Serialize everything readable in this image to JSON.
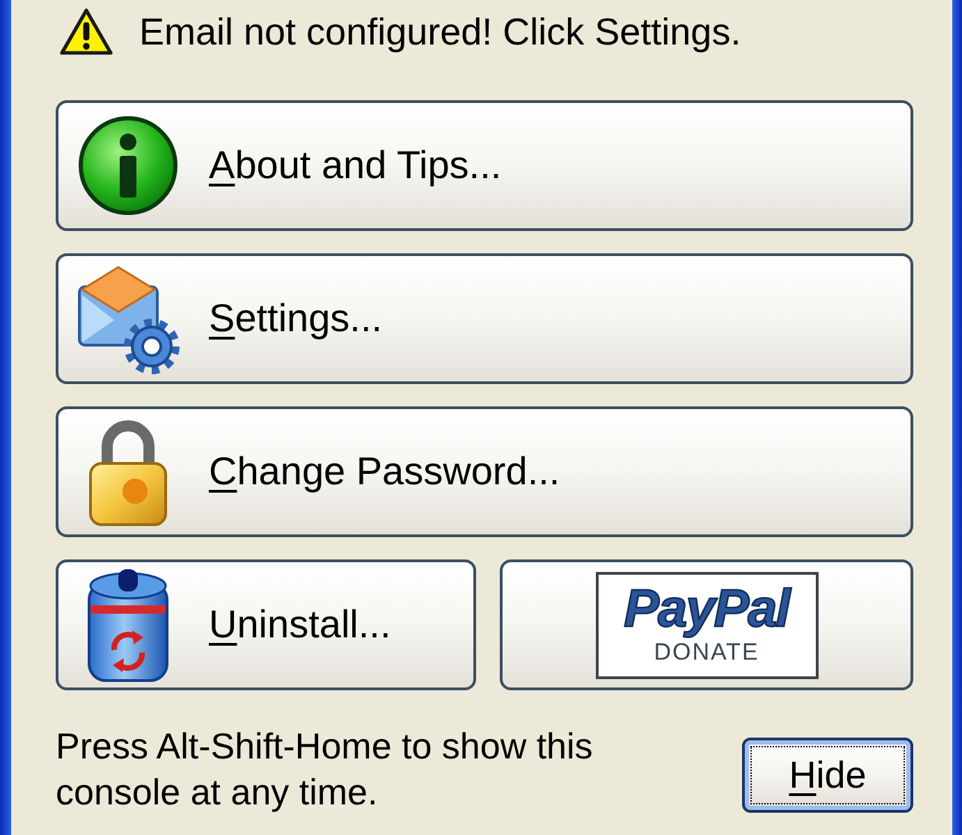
{
  "warning": {
    "text": "Email not configured! Click Settings."
  },
  "buttons": [
    {
      "kind": "info",
      "label": "About and Tips...",
      "initial_underlined": true
    },
    {
      "kind": "settings",
      "label": "Settings...",
      "initial_underlined": true
    },
    {
      "kind": "password",
      "label": "Change Password...",
      "initial_underlined": true
    },
    {
      "kind": "uninstall",
      "label": "Uninstall...",
      "initial_underlined": true
    }
  ],
  "donate_button": {
    "logo": "PayPal",
    "caption": "DONATE"
  },
  "hint": "Press Alt-Shift-Home to show this console at any time.",
  "hide_button": {
    "label": "Hide",
    "initial_underlined": true,
    "default": true,
    "focused": true
  }
}
